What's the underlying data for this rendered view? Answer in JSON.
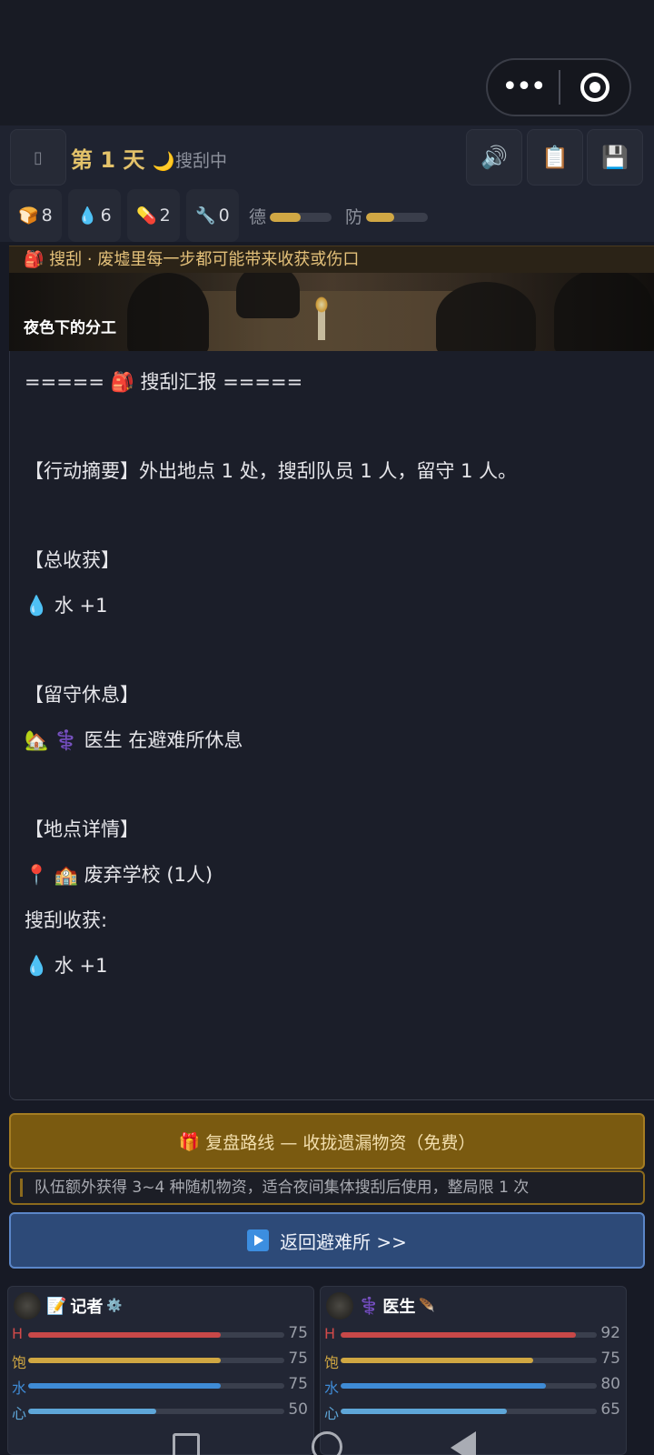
{
  "header": {
    "day": "第 1 天",
    "moon_icon": "🌙",
    "status": "搜刮中",
    "menu_icon": "menu-icon",
    "sound_icon": "🔊",
    "clipboard_icon": "📋",
    "save_icon": "💾"
  },
  "resources": [
    {
      "icon": "🍞",
      "value": "8"
    },
    {
      "icon": "💧",
      "value": "6"
    },
    {
      "icon": "💊",
      "value": "2"
    },
    {
      "icon": "🔧",
      "value": "0"
    }
  ],
  "stats": {
    "virtue": {
      "label": "德",
      "level": 0.5
    },
    "defense": {
      "label": "防",
      "level": 0.45
    }
  },
  "banner": {
    "icon": "🎒",
    "text": "搜刮 · 废墟里每一步都可能带来收获或伤口"
  },
  "scene": {
    "caption": "夜色下的分工"
  },
  "report": {
    "title_prefix": "=====",
    "title_icon": "🎒",
    "title_text": "搜刮汇报",
    "title_suffix": "=====",
    "summary": "【行动摘要】外出地点 1 处，搜刮队员 1 人，留守 1 人。",
    "gain_header": "【总收获】",
    "gain_line": "💧 水 +1",
    "rest_header": "【留守休息】",
    "rest_line": "🏡 ⚕️ 医生 在避难所休息",
    "location_header": "【地点详情】",
    "location_line": "📍 🏫 废弃学校 (1人)",
    "loot_header": "搜刮收获:",
    "loot_line": "💧 水 +1"
  },
  "actions": {
    "review_icon": "🎁",
    "review_label": "复盘路线 — 收拢遗漏物资（免费）",
    "review_note": "队伍额外获得 3~4 种随机物资，适合夜间集体搜刮后使用，整局限 1 次",
    "return_label": "返回避难所 >>"
  },
  "characters": [
    {
      "role_icon": "📝",
      "name": "记者",
      "badge": "⚙️",
      "bars": [
        {
          "label": "H",
          "value": 75,
          "color": "#c84848",
          "label_color": "#d24a4a"
        },
        {
          "label": "饱",
          "value": 75,
          "color": "#d0a742",
          "label_color": "#d0a742"
        },
        {
          "label": "水",
          "value": 75,
          "color": "#3f8bd6",
          "label_color": "#3f8bd6"
        },
        {
          "label": "心",
          "value": 50,
          "color": "#5ea6d8",
          "label_color": "#5ea6d8"
        }
      ]
    },
    {
      "role_icon": "⚕️",
      "name": "医生",
      "badge": "🪶",
      "bars": [
        {
          "label": "H",
          "value": 92,
          "color": "#c84848",
          "label_color": "#d24a4a"
        },
        {
          "label": "饱",
          "value": 75,
          "color": "#d0a742",
          "label_color": "#d0a742"
        },
        {
          "label": "水",
          "value": 80,
          "color": "#3f8bd6",
          "label_color": "#3f8bd6"
        },
        {
          "label": "心",
          "value": 65,
          "color": "#5ea6d8",
          "label_color": "#5ea6d8"
        }
      ]
    }
  ]
}
